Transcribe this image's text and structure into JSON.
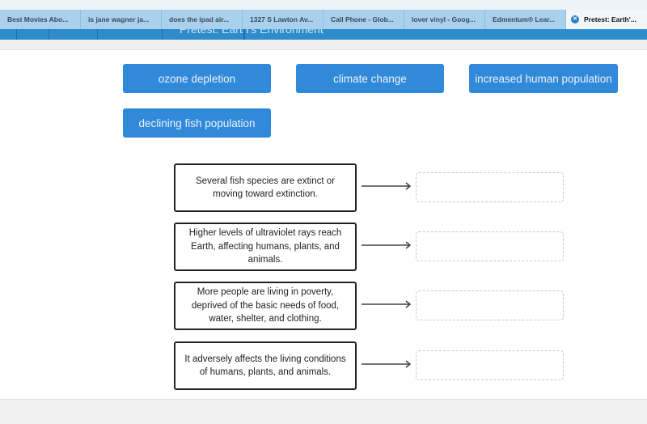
{
  "browser": {
    "tabs": [
      {
        "label": "Best Movies Abo..."
      },
      {
        "label": "is jane wagner ja..."
      },
      {
        "label": "does the ipad air..."
      },
      {
        "label": "1327 S Lawton Av..."
      },
      {
        "label": "Call Phone - Glob..."
      },
      {
        "label": "lover vinyl - Goog..."
      },
      {
        "label": "Edmentum® Lear..."
      },
      {
        "label": "Pretest: Earth'...",
        "active": true,
        "close_icon": "close-circle-icon"
      }
    ]
  },
  "app_header": {
    "title": "Pretest: Earth's Environment"
  },
  "question": {
    "answer_tiles": [
      {
        "label": "ozone depletion"
      },
      {
        "label": "climate change"
      },
      {
        "label": "increased human population"
      },
      {
        "label": "declining fish population"
      }
    ],
    "pairs": [
      {
        "description": "Several fish species are extinct or moving toward extinction.",
        "arrow_icon": "arrow-right-icon",
        "drop_value": ""
      },
      {
        "description": "Higher levels of ultraviolet rays reach Earth, affecting humans, plants, and animals.",
        "arrow_icon": "arrow-right-icon",
        "drop_value": ""
      },
      {
        "description": "More people are living in poverty, deprived of the basic needs of food, water, shelter, and clothing.",
        "arrow_icon": "arrow-right-icon",
        "drop_value": ""
      },
      {
        "description": "It adversely affects the living conditions of humans, plants, and animals.",
        "arrow_icon": "arrow-right-icon",
        "drop_value": ""
      }
    ]
  },
  "colors": {
    "tile_blue": "#3189d9",
    "header_blue": "#2e8ccb",
    "tabbar_blue": "#a9d0ec"
  }
}
